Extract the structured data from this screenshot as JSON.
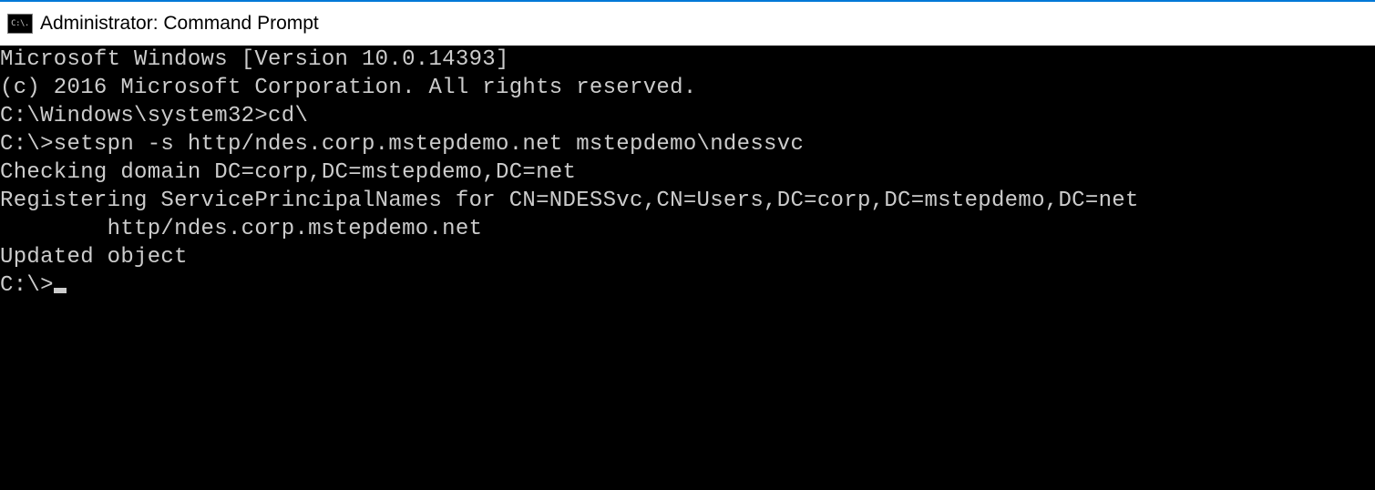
{
  "window": {
    "title": "Administrator: Command Prompt",
    "icon_label": "C:\\."
  },
  "terminal": {
    "lines": [
      "Microsoft Windows [Version 10.0.14393]",
      "(c) 2016 Microsoft Corporation. All rights reserved.",
      "",
      "C:\\Windows\\system32>cd\\",
      "",
      "C:\\>setspn -s http/ndes.corp.mstepdemo.net mstepdemo\\ndessvc",
      "Checking domain DC=corp,DC=mstepdemo,DC=net",
      "",
      "Registering ServicePrincipalNames for CN=NDESSvc,CN=Users,DC=corp,DC=mstepdemo,DC=net",
      "        http/ndes.corp.mstepdemo.net",
      "Updated object",
      "",
      "C:\\>"
    ],
    "cursor_on_last_line": true
  }
}
